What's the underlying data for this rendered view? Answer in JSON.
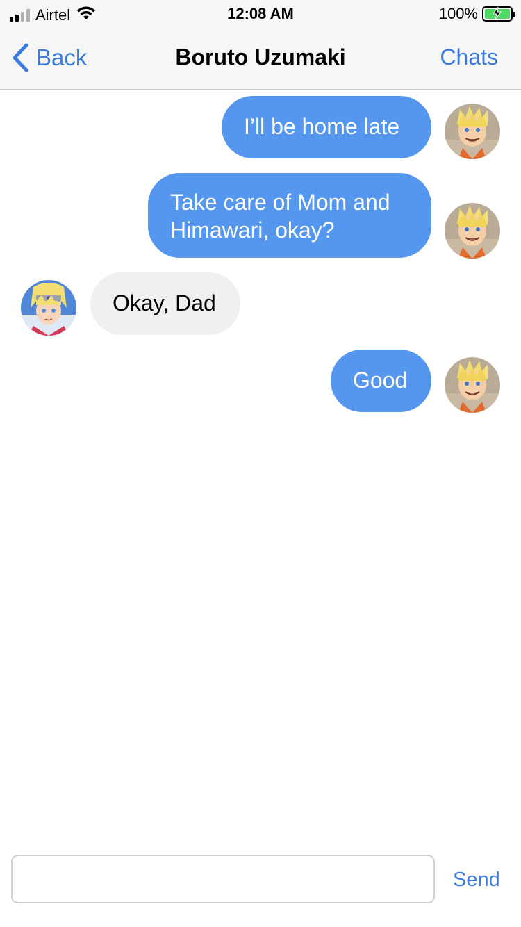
{
  "status_bar": {
    "carrier": "Airtel",
    "time": "12:08 AM",
    "battery_percent": "100%",
    "battery_level": 1.0,
    "battery_color": "#4cd964",
    "signal_bars_active": 2,
    "signal_bars_total": 4
  },
  "nav": {
    "back_label": "Back",
    "title": "Boruto Uzumaki",
    "right_label": "Chats",
    "accent_color": "#3a7be0"
  },
  "messages": [
    {
      "direction": "outgoing",
      "text": "I’ll be home late",
      "avatar": "naruto-avatar"
    },
    {
      "direction": "outgoing",
      "text": "Take care of Mom and Himawari, okay?",
      "avatar": "naruto-avatar"
    },
    {
      "direction": "incoming",
      "text": "Okay, Dad",
      "avatar": "boruto-avatar"
    },
    {
      "direction": "outgoing",
      "text": "Good",
      "avatar": "naruto-avatar"
    }
  ],
  "colors": {
    "outgoing_bubble": "#5597ee",
    "incoming_bubble": "#f0f0f0"
  },
  "composer": {
    "input_value": "",
    "input_placeholder": "",
    "send_label": "Send"
  }
}
